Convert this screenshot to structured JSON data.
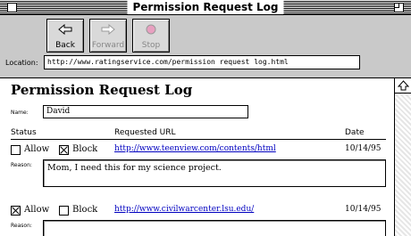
{
  "window": {
    "title": "Permission Request Log"
  },
  "toolbar": {
    "back_label": "Back",
    "forward_label": "Forward",
    "stop_label": "Stop",
    "location_label": "Location:",
    "location_value": "http://www.ratingservice.com/permission request log.html"
  },
  "page": {
    "title": "Permission Request Log",
    "name_label": "Name:",
    "name_value": "David",
    "columns": {
      "status": "Status",
      "url": "Requested URL",
      "date": "Date"
    },
    "allow_label": "Allow",
    "block_label": "Block",
    "reason_label": "Reason:",
    "requests": [
      {
        "allow_checked": false,
        "block_checked": true,
        "url": "http://www.teenview.com/contents/html",
        "date": "10/14/95",
        "reason": "Mom, I need this for my science project."
      },
      {
        "allow_checked": true,
        "block_checked": false,
        "url": "http://www.civilwarcenter.lsu.edu/",
        "date": "10/14/95",
        "reason": ""
      }
    ]
  },
  "icons": {
    "back": "left-arrow-icon",
    "forward": "right-arrow-icon",
    "stop": "stop-icon"
  },
  "colors": {
    "link": "#0000c0",
    "chrome": "#c9c9c9",
    "stop": "#e8a0c0"
  }
}
